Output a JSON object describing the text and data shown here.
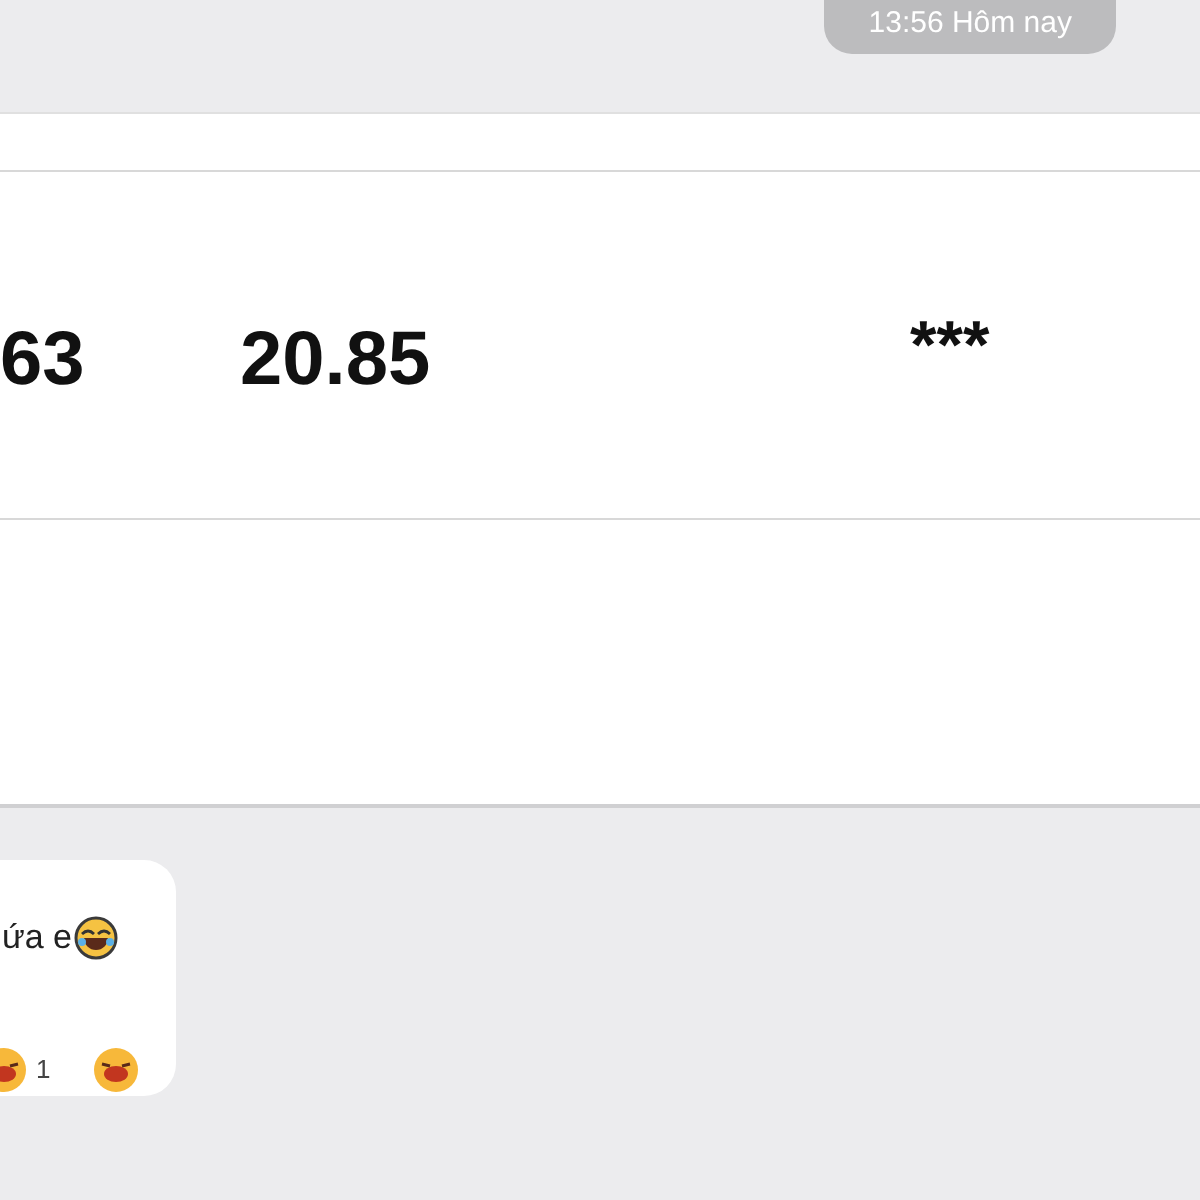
{
  "timestamp": "13:56 Hôm nay",
  "table_row": {
    "column_1": "63",
    "column_2": "20.85",
    "column_3": "***"
  },
  "message": {
    "text": "ứa e",
    "reaction_count": "1"
  }
}
